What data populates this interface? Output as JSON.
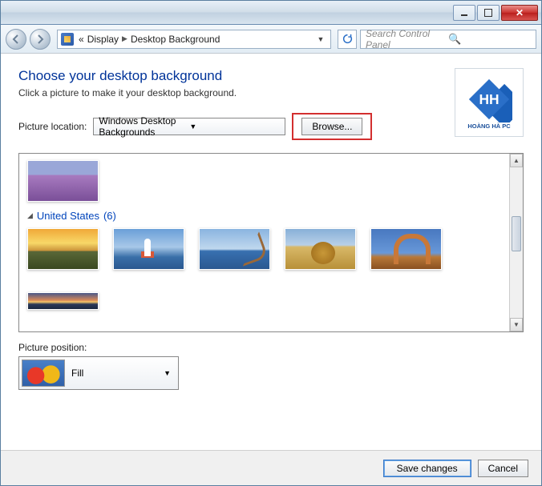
{
  "breadcrumbs": {
    "prefix": "«",
    "part1": "Display",
    "part2": "Desktop Background"
  },
  "search": {
    "placeholder": "Search Control Panel"
  },
  "header": {
    "title": "Choose your desktop background",
    "subtitle": "Click a picture to make it your desktop background."
  },
  "location": {
    "label": "Picture location:",
    "value": "Windows Desktop Backgrounds",
    "browse": "Browse..."
  },
  "logo": {
    "brand": "HOÀNG HÀ PC"
  },
  "category": {
    "name": "United States",
    "count": "(6)"
  },
  "position": {
    "label": "Picture position:",
    "value": "Fill"
  },
  "footer": {
    "save": "Save changes",
    "cancel": "Cancel"
  }
}
